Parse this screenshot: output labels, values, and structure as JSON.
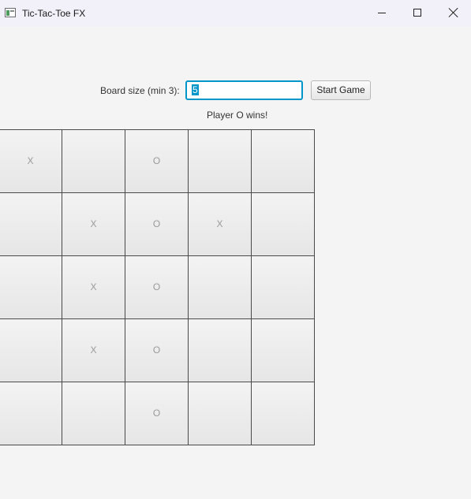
{
  "window": {
    "title": "Tic-Tac-Toe FX",
    "icon": "app-window-icon"
  },
  "controls": {
    "board_size_label": "Board size (min 3):",
    "board_size_value": "5",
    "start_button_label": "Start Game"
  },
  "status": "Player O wins!",
  "board": {
    "size": 5,
    "cells": [
      [
        "X",
        "",
        "O",
        "",
        ""
      ],
      [
        "",
        "X",
        "O",
        "X",
        ""
      ],
      [
        "",
        "X",
        "O",
        "",
        ""
      ],
      [
        "",
        "X",
        "O",
        "",
        ""
      ],
      [
        "",
        "",
        "O",
        "",
        ""
      ]
    ]
  },
  "colors": {
    "focus_border": "#0096c9",
    "cell_text": "#9a9a9a",
    "grid_line": "#4a4a4a"
  }
}
